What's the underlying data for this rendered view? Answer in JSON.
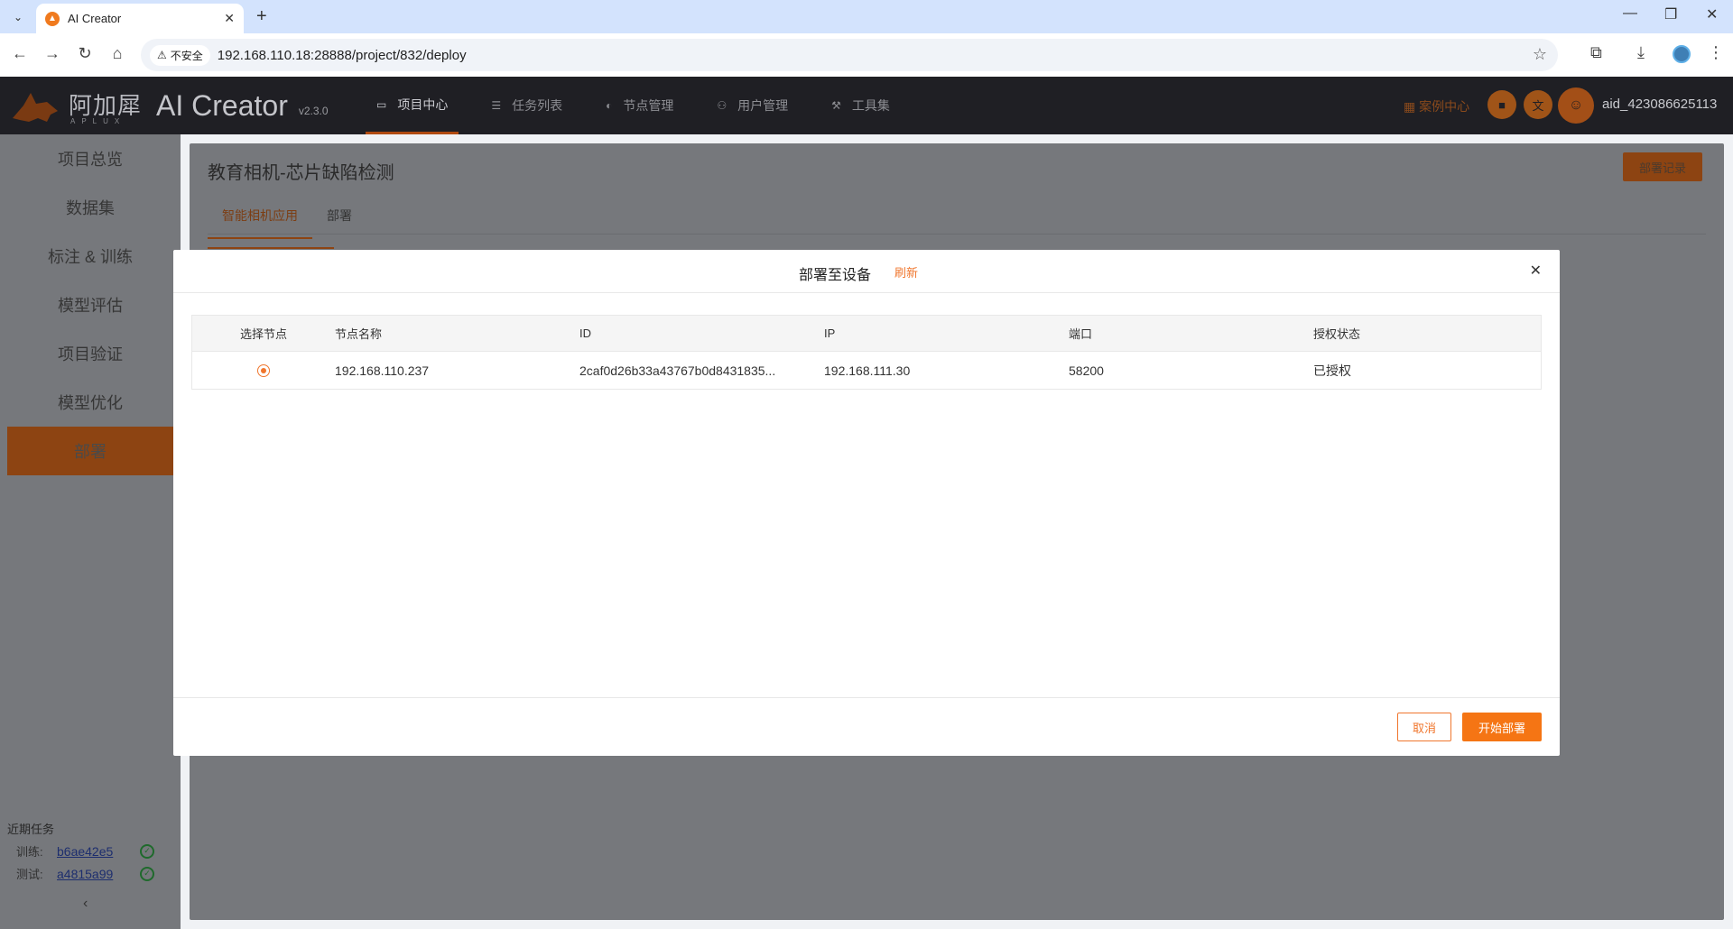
{
  "browser": {
    "tab_title": "AI Creator",
    "insecure_label": "不安全",
    "url": "192.168.110.18:28888/project/832/deploy"
  },
  "header": {
    "logo_cn": "阿加犀",
    "logo_en": "APLUX",
    "app_name": "AI Creator",
    "version": "v2.3.0",
    "nav": [
      {
        "label": "项目中心",
        "active": true
      },
      {
        "label": "任务列表"
      },
      {
        "label": "节点管理"
      },
      {
        "label": "用户管理"
      },
      {
        "label": "工具集"
      }
    ],
    "case_center": "案例中心",
    "username": "aid_423086625113"
  },
  "sidebar": {
    "items": [
      {
        "label": "项目总览"
      },
      {
        "label": "数据集"
      },
      {
        "label": "标注 & 训练"
      },
      {
        "label": "模型评估"
      },
      {
        "label": "项目验证"
      },
      {
        "label": "模型优化"
      },
      {
        "label": "部署",
        "active": true
      }
    ],
    "recent_title": "近期任务",
    "recent": [
      {
        "label": "训练:",
        "id": "b6ae42e5"
      },
      {
        "label": "测试:",
        "id": "a4815a99"
      }
    ]
  },
  "main": {
    "project_title": "教育相机-芯片缺陷检测",
    "deploy_log_button": "部署记录",
    "tabs": [
      {
        "label": "智能相机应用",
        "active": true
      },
      {
        "label": "部署"
      }
    ]
  },
  "modal": {
    "title": "部署至设备",
    "refresh": "刷新",
    "columns": [
      "选择节点",
      "节点名称",
      "ID",
      "IP",
      "端口",
      "授权状态"
    ],
    "rows": [
      {
        "name": "192.168.110.237",
        "id": "2caf0d26b33a43767b0d8431835...",
        "ip": "192.168.111.30",
        "port": "58200",
        "auth": "已授权",
        "selected": true
      }
    ],
    "cancel": "取消",
    "start_deploy": "开始部署"
  },
  "colors": {
    "accent": "#f57514",
    "header_bg": "#1f1f24",
    "overlay_gray": "#76787c"
  }
}
